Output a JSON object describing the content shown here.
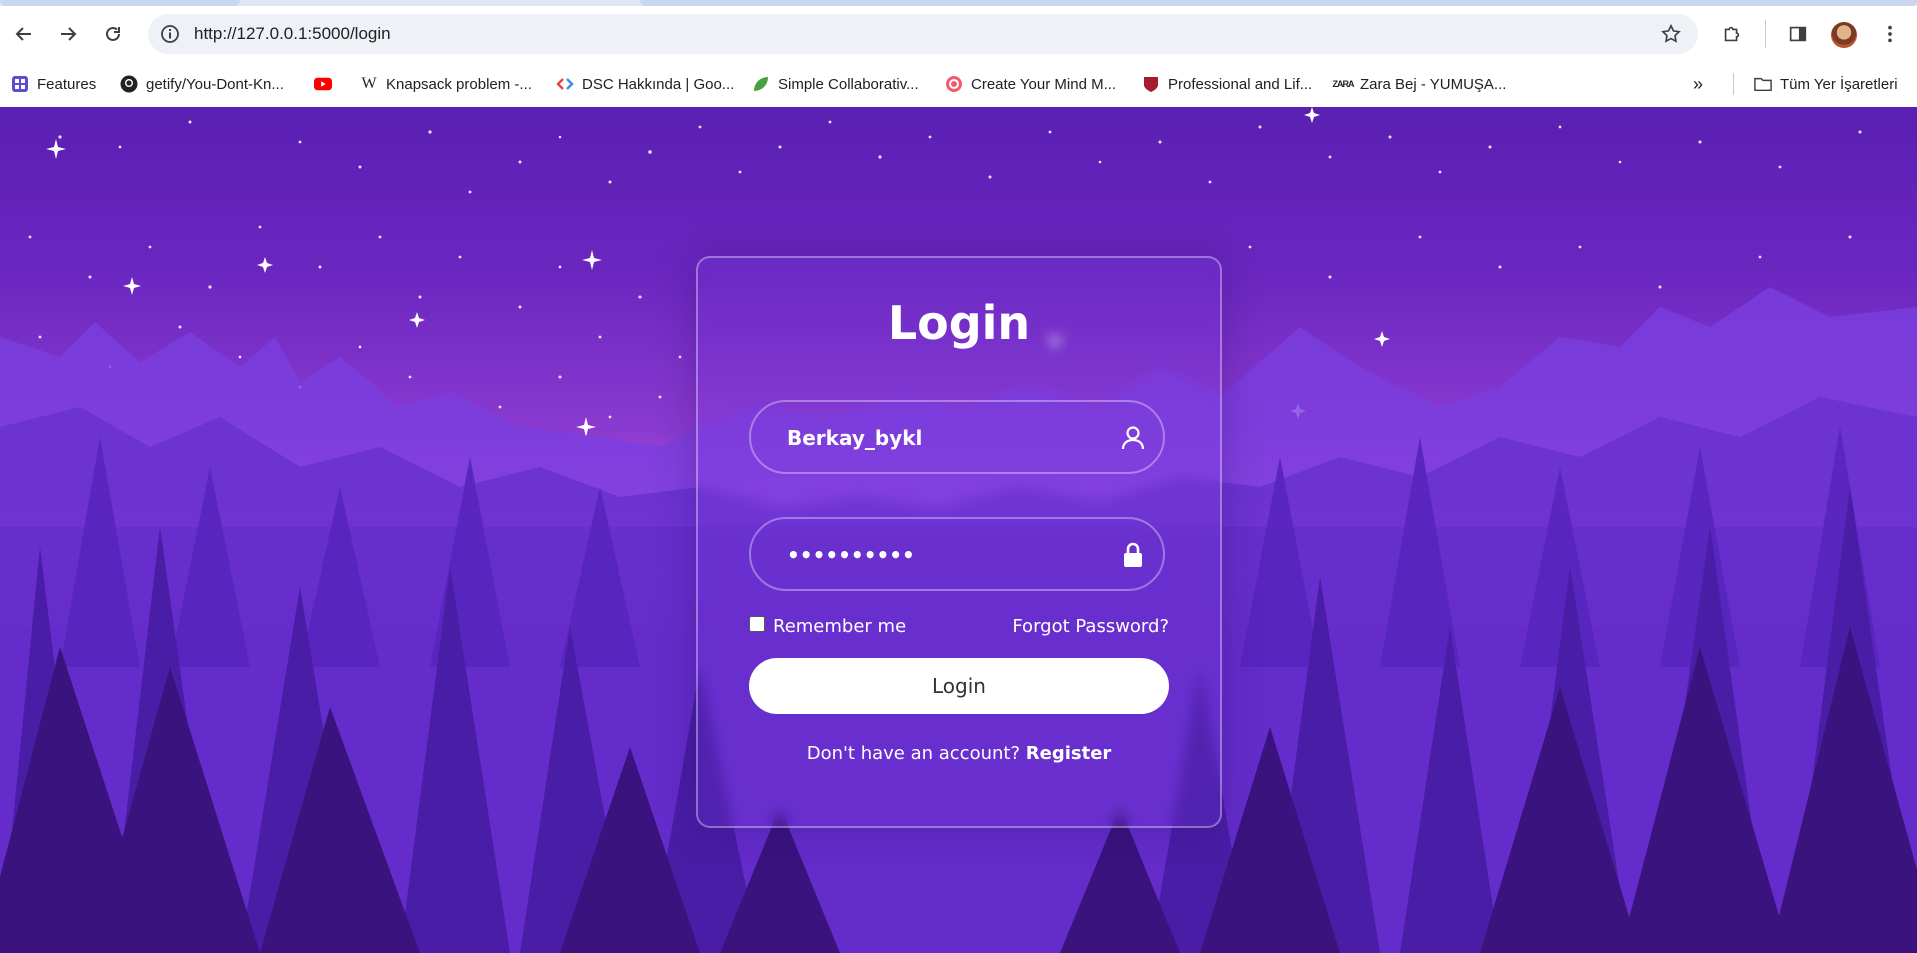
{
  "browser": {
    "url": "http://127.0.0.1:5000/login",
    "bookmarks": [
      {
        "label": "Features",
        "icon": "grid-icon",
        "color": "#5b4bd6"
      },
      {
        "label": "getify/You-Dont-Kn...",
        "icon": "github-icon",
        "color": "#222"
      },
      {
        "label": "",
        "icon": "youtube-icon",
        "color": "#ff0000"
      },
      {
        "label": "Knapsack problem -...",
        "icon": "wikipedia-icon",
        "color": "#222"
      },
      {
        "label": "DSC Hakkında | Goo...",
        "icon": "dsc-icon",
        "color": "#4285f4"
      },
      {
        "label": "Simple Collaborativ...",
        "icon": "overleaf-icon",
        "color": "#47a141"
      },
      {
        "label": "Create Your Mind M...",
        "icon": "mindmap-icon",
        "color": "#f15b6c"
      },
      {
        "label": "Professional and Lif...",
        "icon": "harvard-icon",
        "color": "#a51c30"
      },
      {
        "label": "Zara Bej - YUMUŞA...",
        "icon": "zara-icon",
        "color": "#222"
      }
    ],
    "all_bookmarks_label": "Tüm Yer İşaretleri"
  },
  "login": {
    "title": "Login",
    "username_value": "Berkay_bykl",
    "password_value": "••••••••••",
    "remember_label": "Remember me",
    "forgot_label": "Forgot Password?",
    "submit_label": "Login",
    "no_account_text": "Don't have an account?",
    "register_label": "Register"
  }
}
